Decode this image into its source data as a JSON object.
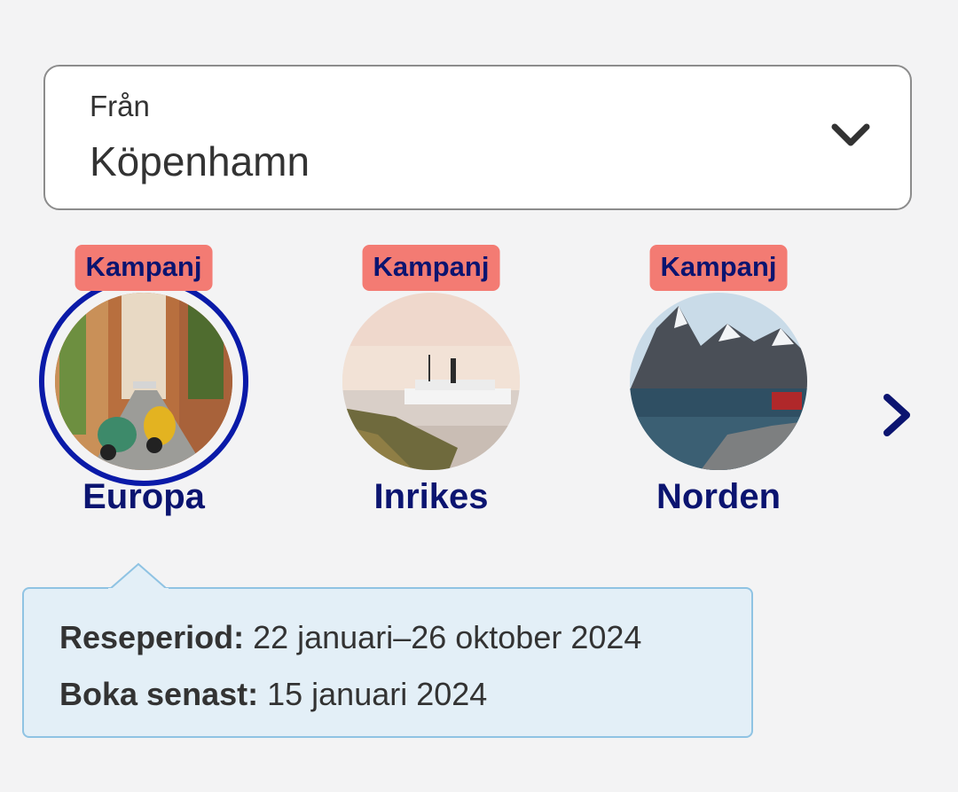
{
  "origin": {
    "label": "Från",
    "value": "Köpenhamn",
    "icon": "chevron-down-icon"
  },
  "destinations": [
    {
      "badge": "Kampanj",
      "name": "Europa",
      "selected": true,
      "image": "street-scooters-photo"
    },
    {
      "badge": "Kampanj",
      "name": "Inrikes",
      "selected": false,
      "image": "steamboat-lake-photo"
    },
    {
      "badge": "Kampanj",
      "name": "Norden",
      "selected": false,
      "image": "mountain-fjord-photo"
    }
  ],
  "next_icon": "chevron-right-icon",
  "info": {
    "period_label": "Reseperiod:",
    "period_value": "22 januari–26 oktober 2024",
    "book_label": "Boka senast:",
    "book_value": "15 januari 2024"
  },
  "colors": {
    "brand_navy": "#0b1470",
    "badge": "#f37b73",
    "selected_ring": "#0a1aa8",
    "info_background": "#e3eff7",
    "info_border": "#8fc3e3"
  }
}
